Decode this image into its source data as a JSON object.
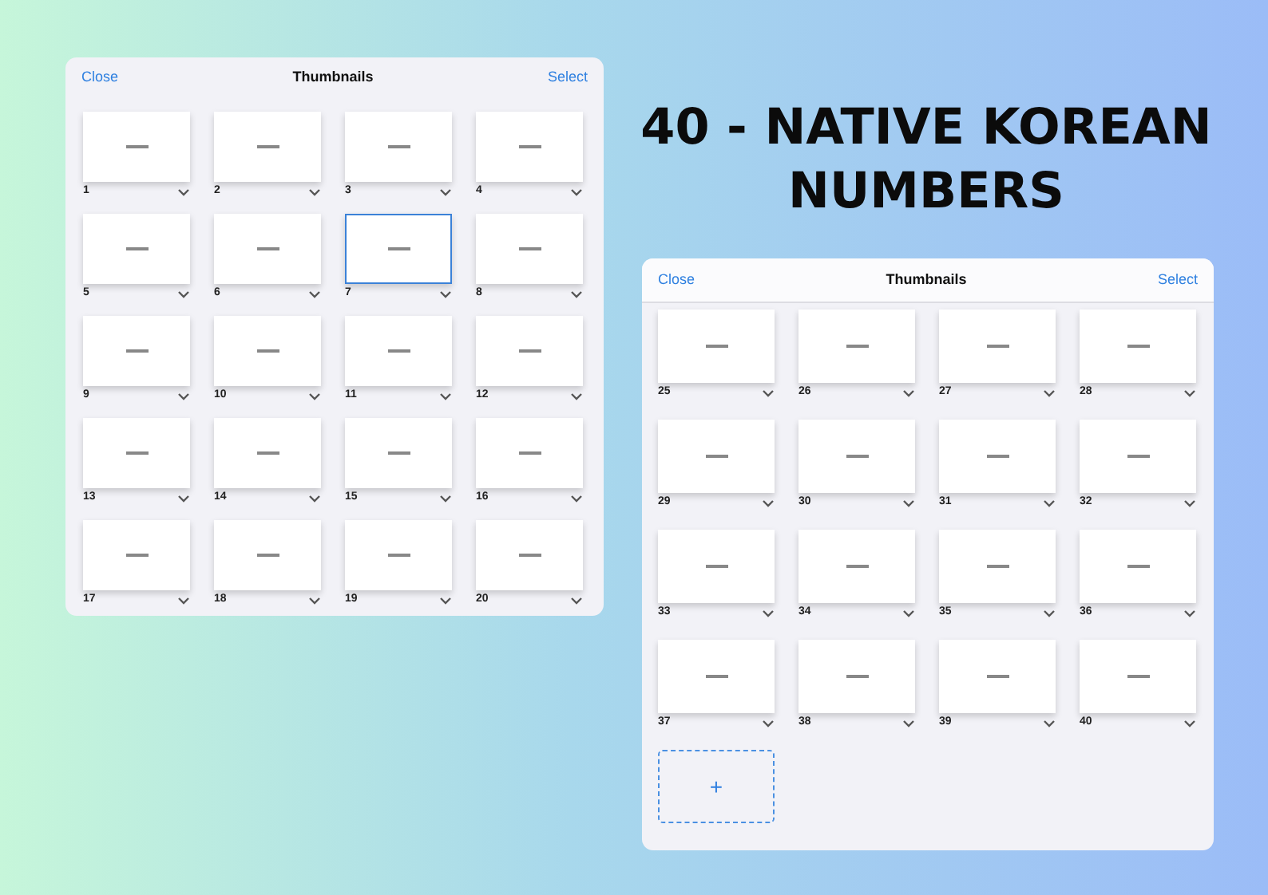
{
  "title": "40 - NATIVE KOREAN NUMBERS",
  "windows": [
    {
      "kind": "plain",
      "header": {
        "close": "Close",
        "title": "Thumbnails",
        "select": "Select"
      },
      "slides": [
        {
          "number": "1",
          "selected": false
        },
        {
          "number": "2",
          "selected": false
        },
        {
          "number": "3",
          "selected": false
        },
        {
          "number": "4",
          "selected": false
        },
        {
          "number": "5",
          "selected": false
        },
        {
          "number": "6",
          "selected": false
        },
        {
          "number": "7",
          "selected": true
        },
        {
          "number": "8",
          "selected": false
        },
        {
          "number": "9",
          "selected": false
        },
        {
          "number": "10",
          "selected": false
        },
        {
          "number": "11",
          "selected": false
        },
        {
          "number": "12",
          "selected": false
        },
        {
          "number": "13",
          "selected": false
        },
        {
          "number": "14",
          "selected": false
        },
        {
          "number": "15",
          "selected": false
        },
        {
          "number": "16",
          "selected": false
        },
        {
          "number": "17",
          "selected": false
        },
        {
          "number": "18",
          "selected": false
        },
        {
          "number": "19",
          "selected": false
        },
        {
          "number": "20",
          "selected": false
        }
      ]
    },
    {
      "kind": "bar",
      "header": {
        "close": "Close",
        "title": "Thumbnails",
        "select": "Select"
      },
      "slides": [
        {
          "number": "25",
          "selected": false
        },
        {
          "number": "26",
          "selected": false
        },
        {
          "number": "27",
          "selected": false
        },
        {
          "number": "28",
          "selected": false
        },
        {
          "number": "29",
          "selected": false
        },
        {
          "number": "30",
          "selected": false
        },
        {
          "number": "31",
          "selected": false
        },
        {
          "number": "32",
          "selected": false
        },
        {
          "number": "33",
          "selected": false
        },
        {
          "number": "34",
          "selected": false
        },
        {
          "number": "35",
          "selected": false
        },
        {
          "number": "36",
          "selected": false
        },
        {
          "number": "37",
          "selected": false
        },
        {
          "number": "38",
          "selected": false
        },
        {
          "number": "39",
          "selected": false
        },
        {
          "number": "40",
          "selected": false
        }
      ],
      "add_button": "+"
    }
  ]
}
